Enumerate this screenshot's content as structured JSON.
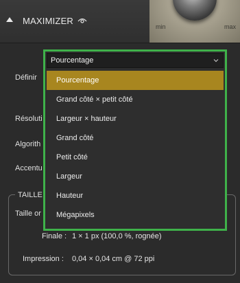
{
  "header": {
    "title": "MAXIMIZER",
    "icon": "eye-icon",
    "dial": {
      "min_label": "min",
      "max_label": "max"
    }
  },
  "labels": {
    "definir": "Définir",
    "resolution": "Résoluti",
    "algorithme": "Algorith",
    "accentuation": "Accentu"
  },
  "dropdown": {
    "selected": "Pourcentage",
    "options": [
      "Pourcentage",
      "Grand côté × petit côté",
      "Largeur × hauteur",
      "Grand côté",
      "Petit côté",
      "Largeur",
      "Hauteur",
      "Mégapixels"
    ],
    "highlighted_index": 0,
    "highlight_color": "#a8861f",
    "focus_border_color": "#3fb24a"
  },
  "taille": {
    "title": "TAILLE",
    "taille_label": "Taille or",
    "finale_label": "Finale :",
    "finale_value": "1 × 1 px (100,0 %, rognée)",
    "impression_label": "Impression :",
    "impression_value": "0,04 × 0,04 cm @ 72 ppi"
  }
}
